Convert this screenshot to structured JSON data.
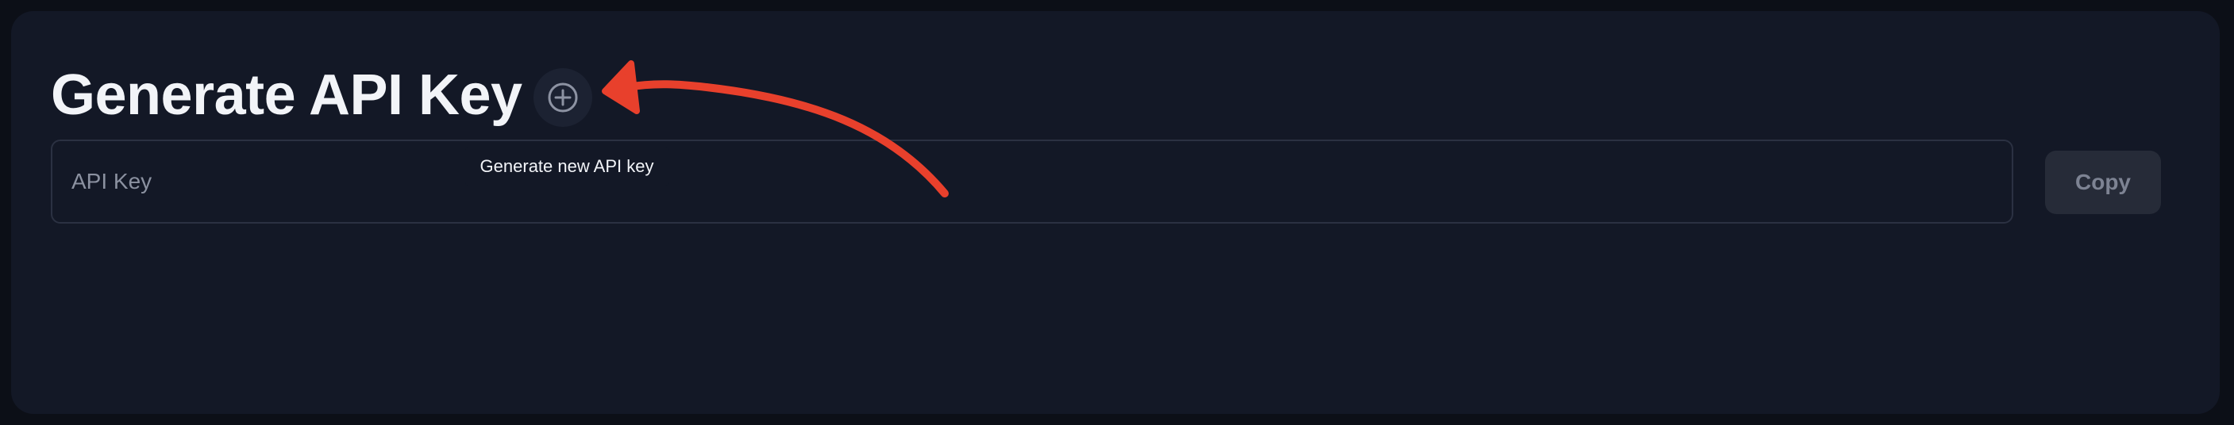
{
  "section": {
    "title": "Generate API Key"
  },
  "generate_button": {
    "icon": "plus-circle-icon",
    "tooltip": "Generate new API key"
  },
  "api_key_field": {
    "value": "",
    "placeholder": "API Key"
  },
  "copy_button": {
    "label": "Copy",
    "enabled": false
  },
  "colors": {
    "background": "#0c0f17",
    "card": "#131826",
    "text": "#f2f4f8",
    "annotation_arrow": "#e8402c"
  }
}
